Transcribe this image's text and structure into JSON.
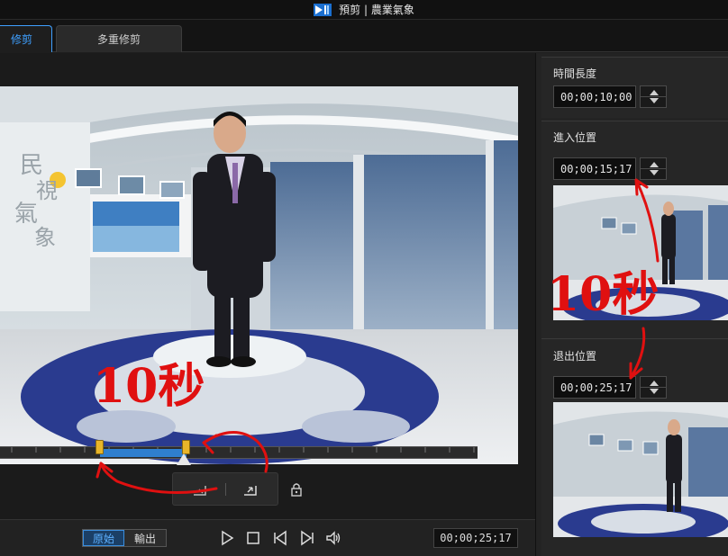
{
  "window": {
    "title": "預剪 | 農業氣象"
  },
  "tabs": [
    {
      "label": "修剪",
      "active": true
    },
    {
      "label": "多重修剪",
      "active": false
    }
  ],
  "right_panel": {
    "duration": {
      "label": "時間長度",
      "value": "00;00;10;00"
    },
    "mark_in": {
      "label": "進入位置",
      "value": "00;00;15;17"
    },
    "mark_out": {
      "label": "退出位置",
      "value": "00;00;25;17"
    }
  },
  "preview": {
    "logo_text": [
      "民",
      "視",
      "氣",
      "象"
    ]
  },
  "controls": {
    "original_label": "原始",
    "output_label": "輸出",
    "timecode": "00;00;25;17"
  },
  "annotations": {
    "main_note": "10秒",
    "side_note": "10秒"
  },
  "colors": {
    "accent": "#3fa0ff",
    "marker": "#e8b52a",
    "annotation": "#e01010",
    "selection": "#2f7fcf"
  }
}
